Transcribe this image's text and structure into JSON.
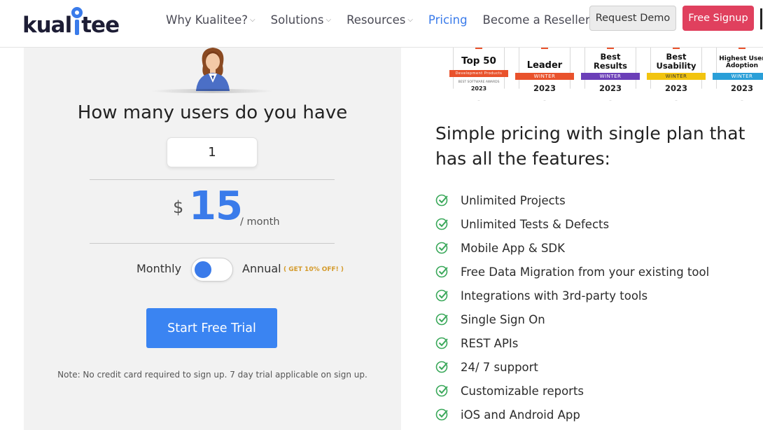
{
  "brand": {
    "logo_text_before": "kual",
    "logo_text_after": "tee",
    "accent_color": "#3a7bea",
    "signup_color": "#e0405e"
  },
  "nav": {
    "items": [
      {
        "label": "Why Kualitee?",
        "dropdown": true
      },
      {
        "label": "Solutions",
        "dropdown": true
      },
      {
        "label": "Resources",
        "dropdown": true
      },
      {
        "label": "Pricing",
        "dropdown": false,
        "active": true
      },
      {
        "label": "Become a Reseller",
        "dropdown": false
      }
    ],
    "request_demo": "Request Demo",
    "free_signup": "Free Signup"
  },
  "calculator": {
    "question": "How many users do you have",
    "users_value": "1",
    "currency": "$",
    "price": "15",
    "period": "/ month",
    "monthly_label": "Monthly",
    "annual_label": "Annual",
    "annual_discount": "( GET 10% OFF! )",
    "billing_selected": "Monthly",
    "cta": "Start Free Trial",
    "note": "Note: No credit card required to sign up. 7 day trial applicable on sign up."
  },
  "badges": [
    {
      "line1": "Top 50",
      "ribbon": "Development Products",
      "tiny": "BEST SOFTWARE AWARDS",
      "year": "2023",
      "ribbon_color": "#e9522c",
      "icon": "award-badge-icon"
    },
    {
      "line1": "Leader",
      "ribbon": "WINTER",
      "year": "2023",
      "ribbon_color": "#e9522c",
      "icon": "award-badge-icon"
    },
    {
      "line1": "Best",
      "line2": "Results",
      "ribbon": "WINTER",
      "year": "2023",
      "ribbon_color": "#6b3fb8",
      "icon": "award-badge-icon"
    },
    {
      "line1": "Best",
      "line2": "Usability",
      "ribbon": "WINTER",
      "year": "2023",
      "ribbon_color": "#f2c40f",
      "icon": "award-badge-icon"
    },
    {
      "line1": "Highest User",
      "line2": "Adoption",
      "ribbon": "WINTER",
      "year": "2023",
      "ribbon_color": "#2a9fd8",
      "icon": "award-badge-icon"
    }
  ],
  "features": {
    "headline": "Simple pricing with single plan that has all the features:",
    "items": [
      "Unlimited Projects",
      "Unlimited Tests & Defects",
      "Mobile App & SDK",
      "Free Data Migration from your existing tool",
      "Integrations with 3rd-party tools",
      "Single Sign On",
      "REST APIs",
      "24/ 7 support",
      "Customizable reports",
      "iOS and Android App"
    ],
    "check_color": "#3aa85a"
  }
}
